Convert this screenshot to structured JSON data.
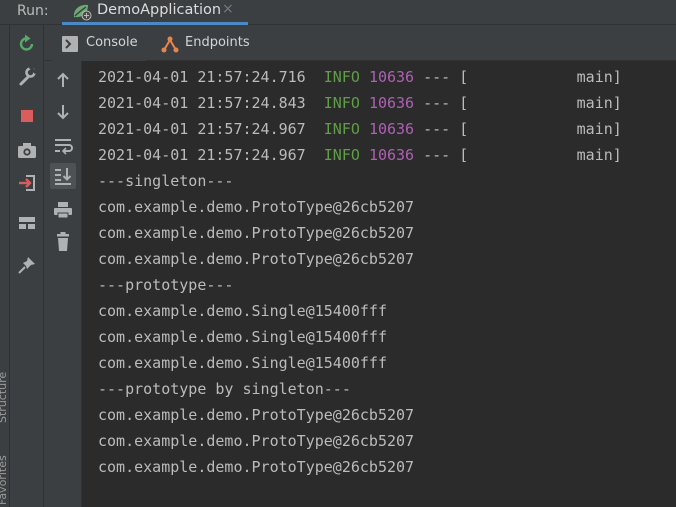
{
  "run": {
    "label": "Run:",
    "tab_title": "DemoApplication",
    "close_glyph": "×"
  },
  "sidebar": {
    "vertical_labels": [
      "Structure",
      "Favorites"
    ]
  },
  "tabs": [
    {
      "label": "Console"
    },
    {
      "label": "Endpoints"
    }
  ],
  "colors": {
    "info": "#5f9d47",
    "pid": "#b05fb6",
    "text": "#bbbbbb",
    "accent": "#4a88c7"
  },
  "console": {
    "log_lines": [
      {
        "timestamp": "2021-04-01 21:57:24.716",
        "level": "INFO",
        "pid": "10636",
        "sep": "--- [",
        "thread": "main]"
      },
      {
        "timestamp": "2021-04-01 21:57:24.843",
        "level": "INFO",
        "pid": "10636",
        "sep": "--- [",
        "thread": "main]"
      },
      {
        "timestamp": "2021-04-01 21:57:24.967",
        "level": "INFO",
        "pid": "10636",
        "sep": "--- [",
        "thread": "main]"
      },
      {
        "timestamp": "2021-04-01 21:57:24.967",
        "level": "INFO",
        "pid": "10636",
        "sep": "--- [",
        "thread": "main]"
      }
    ],
    "output_lines": [
      "---singleton---",
      "com.example.demo.ProtoType@26cb5207",
      "com.example.demo.ProtoType@26cb5207",
      "com.example.demo.ProtoType@26cb5207",
      "---prototype---",
      "com.example.demo.Single@15400fff",
      "com.example.demo.Single@15400fff",
      "com.example.demo.Single@15400fff",
      "---prototype by singleton---",
      "com.example.demo.ProtoType@26cb5207",
      "com.example.demo.ProtoType@26cb5207",
      "com.example.demo.ProtoType@26cb5207"
    ]
  }
}
